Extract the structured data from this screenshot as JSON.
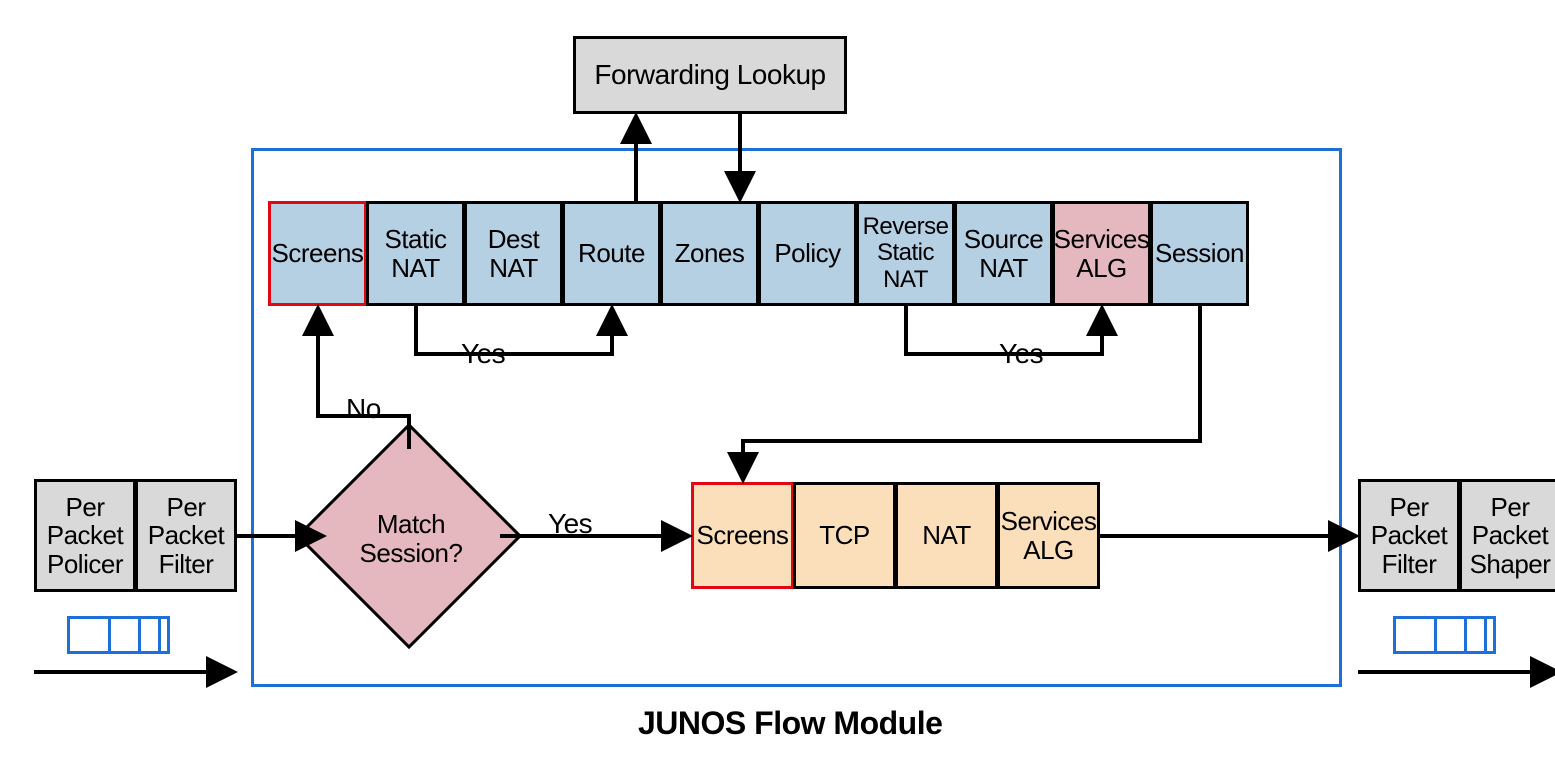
{
  "forwarding_lookup": "Forwarding Lookup",
  "top_row": {
    "screens": "Screens",
    "static_nat": "Static NAT",
    "dest_nat": "Dest NAT",
    "route": "Route",
    "zones": "Zones",
    "policy": "Policy",
    "reverse_static_nat": "Reverse Static NAT",
    "source_nat": "Source NAT",
    "services_alg": "Services ALG",
    "session": "Session"
  },
  "decision": "Match Session?",
  "bottom_row": {
    "screens": "Screens",
    "tcp": "TCP",
    "nat": "NAT",
    "services_alg": "Services ALG"
  },
  "left": {
    "policer": "Per Packet Policer",
    "filter": "Per Packet Filter"
  },
  "right": {
    "filter": "Per Packet Filter",
    "shaper": "Per Packet Shaper"
  },
  "labels": {
    "yes1": "Yes",
    "yes2": "Yes",
    "yes3": "Yes",
    "no": "No"
  },
  "title": "JUNOS Flow Module"
}
